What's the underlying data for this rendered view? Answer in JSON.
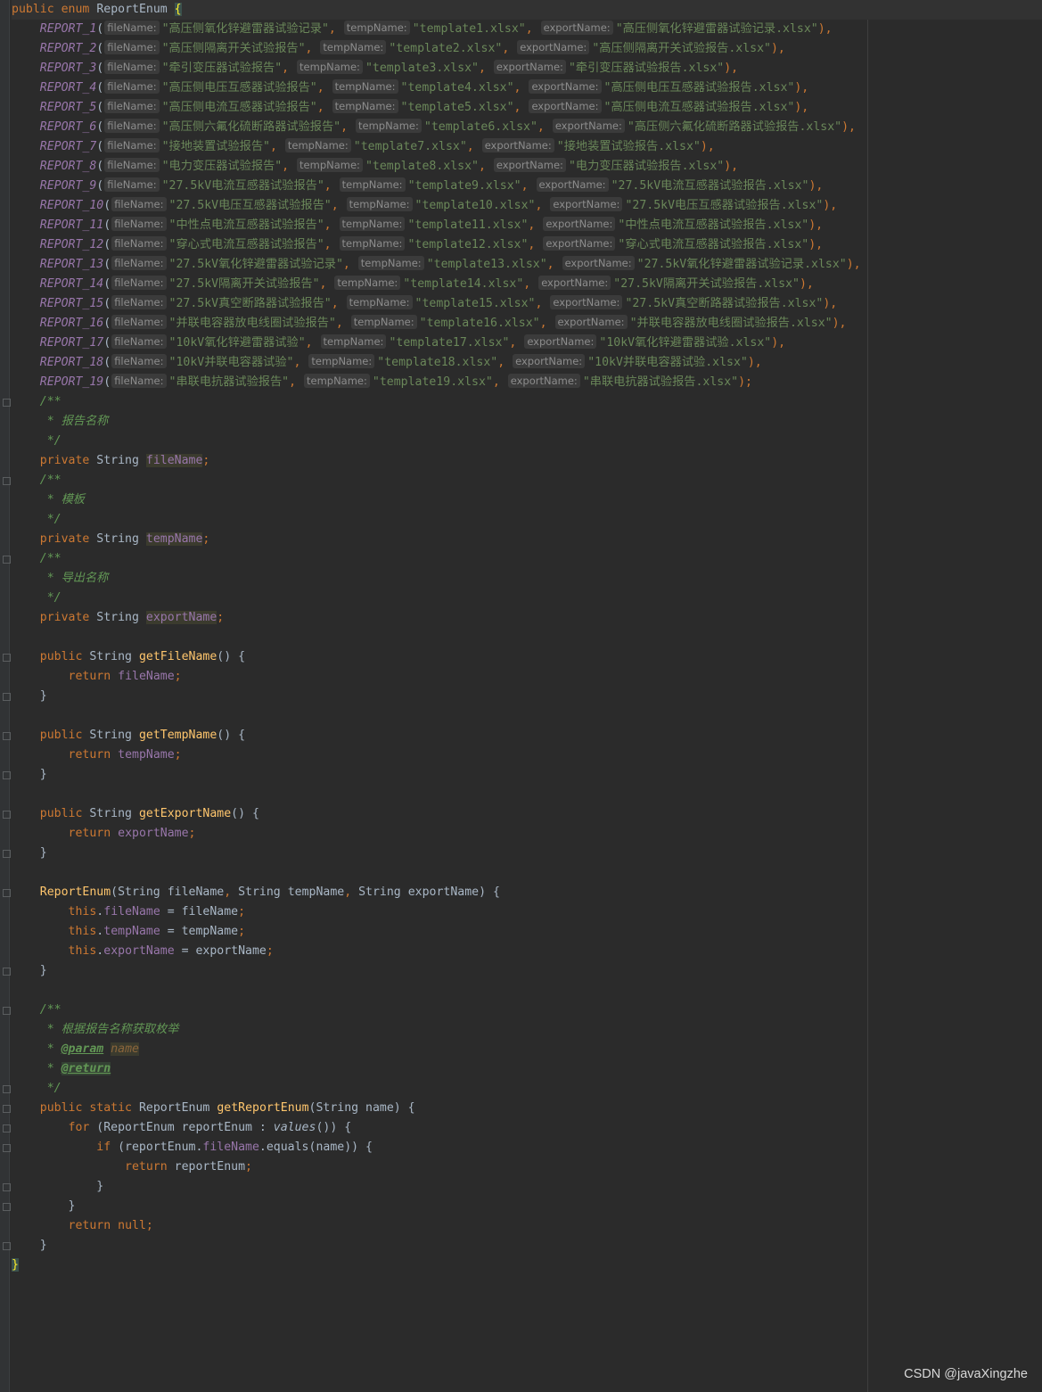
{
  "watermark": "CSDN @javaXingzhe",
  "header": {
    "kw_public": "public",
    "kw_enum": "enum",
    "class_name": "ReportEnum",
    "brace": "{"
  },
  "hints": {
    "file": "fileName:",
    "temp": "tempName:",
    "export": "exportName:"
  },
  "entries": [
    {
      "name": "REPORT_1",
      "file": "\"高压侧氧化锌避雷器试验记录\"",
      "temp": "\"template1.xlsx\"",
      "export": "\"高压侧氧化锌避雷器试验记录.xlsx\"",
      "end": "),"
    },
    {
      "name": "REPORT_2",
      "file": "\"高压侧隔离开关试验报告\"",
      "temp": "\"template2.xlsx\"",
      "export": "\"高压侧隔离开关试验报告.xlsx\"",
      "end": "),"
    },
    {
      "name": "REPORT_3",
      "file": "\"牵引变压器试验报告\"",
      "temp": "\"template3.xlsx\"",
      "export": "\"牵引变压器试验报告.xlsx\"",
      "end": "),"
    },
    {
      "name": "REPORT_4",
      "file": "\"高压侧电压互感器试验报告\"",
      "temp": "\"template4.xlsx\"",
      "export": "\"高压侧电压互感器试验报告.xlsx\"",
      "end": "),"
    },
    {
      "name": "REPORT_5",
      "file": "\"高压侧电流互感器试验报告\"",
      "temp": "\"template5.xlsx\"",
      "export": "\"高压侧电流互感器试验报告.xlsx\"",
      "end": "),"
    },
    {
      "name": "REPORT_6",
      "file": "\"高压侧六氟化硫断路器试验报告\"",
      "temp": "\"template6.xlsx\"",
      "export": "\"高压侧六氟化硫断路器试验报告.xlsx\"",
      "end": "),"
    },
    {
      "name": "REPORT_7",
      "file": "\"接地装置试验报告\"",
      "temp": "\"template7.xlsx\"",
      "export": "\"接地装置试验报告.xlsx\"",
      "end": "),"
    },
    {
      "name": "REPORT_8",
      "file": "\"电力变压器试验报告\"",
      "temp": "\"template8.xlsx\"",
      "export": "\"电力变压器试验报告.xlsx\"",
      "end": "),"
    },
    {
      "name": "REPORT_9",
      "file": "\"27.5kV电流互感器试验报告\"",
      "temp": "\"template9.xlsx\"",
      "export": "\"27.5kV电流互感器试验报告.xlsx\"",
      "end": "),"
    },
    {
      "name": "REPORT_10",
      "file": "\"27.5kV电压互感器试验报告\"",
      "temp": "\"template10.xlsx\"",
      "export": "\"27.5kV电压互感器试验报告.xlsx\"",
      "end": "),"
    },
    {
      "name": "REPORT_11",
      "file": "\"中性点电流互感器试验报告\"",
      "temp": "\"template11.xlsx\"",
      "export": "\"中性点电流互感器试验报告.xlsx\"",
      "end": "),"
    },
    {
      "name": "REPORT_12",
      "file": "\"穿心式电流互感器试验报告\"",
      "temp": "\"template12.xlsx\"",
      "export": "\"穿心式电流互感器试验报告.xlsx\"",
      "end": "),"
    },
    {
      "name": "REPORT_13",
      "file": "\"27.5kV氧化锌避雷器试验记录\"",
      "temp": "\"template13.xlsx\"",
      "export": "\"27.5kV氧化锌避雷器试验记录.xlsx\"",
      "end": "),"
    },
    {
      "name": "REPORT_14",
      "file": "\"27.5kV隔离开关试验报告\"",
      "temp": "\"template14.xlsx\"",
      "export": "\"27.5kV隔离开关试验报告.xlsx\"",
      "end": "),"
    },
    {
      "name": "REPORT_15",
      "file": "\"27.5kV真空断路器试验报告\"",
      "temp": "\"template15.xlsx\"",
      "export": "\"27.5kV真空断路器试验报告.xlsx\"",
      "end": "),"
    },
    {
      "name": "REPORT_16",
      "file": "\"并联电容器放电线圈试验报告\"",
      "temp": "\"template16.xlsx\"",
      "export": "\"并联电容器放电线圈试验报告.xlsx\"",
      "end": "),"
    },
    {
      "name": "REPORT_17",
      "file": "\"10kV氧化锌避雷器试验\"",
      "temp": "\"template17.xlsx\"",
      "export": "\"10kV氧化锌避雷器试验.xlsx\"",
      "end": "),"
    },
    {
      "name": "REPORT_18",
      "file": "\"10kV并联电容器试验\"",
      "temp": "\"template18.xlsx\"",
      "export": "\"10kV并联电容器试验.xlsx\"",
      "end": "),"
    },
    {
      "name": "REPORT_19",
      "file": "\"串联电抗器试验报告\"",
      "temp": "\"template19.xlsx\"",
      "export": "\"串联电抗器试验报告.xlsx\"",
      "end": ");"
    }
  ],
  "comments": {
    "open": "/**",
    "close": " */",
    "file_desc": " * 报告名称",
    "temp_desc": " * 模板",
    "export_desc": " * 导出名称",
    "method_desc": " * 根据报告名称获取枚举",
    "star": " * ",
    "param_tag": "@param",
    "param_name": "name",
    "return_tag": "@return"
  },
  "fields": {
    "kw_private": "private",
    "type": "String",
    "file": "fileName",
    "temp": "tempName",
    "export": "exportName",
    "semi": ";"
  },
  "getters": [
    {
      "name": "getFileName",
      "field": "fileName"
    },
    {
      "name": "getTempName",
      "field": "tempName"
    },
    {
      "name": "getExportName",
      "field": "exportName"
    }
  ],
  "code": {
    "public": "public",
    "static": "static",
    "String": "String",
    "return": "return",
    "this": "this",
    "for": "for",
    "if": "if",
    "null": "null",
    "open_paren_close": "() {",
    "close_brace": "}",
    "ctor_name": "ReportEnum",
    "ctor_params_open": "(String fileName",
    "comma": ",",
    "param2": " String tempName",
    "param3": " String exportName",
    "ctor_params_close": ") {",
    "assign_file": " = fileName",
    "assign_temp": " = tempName",
    "assign_export": " = exportName",
    "dot": ".",
    "method_ret": "ReportEnum",
    "method_name": "getReportEnum",
    "method_params": "(String name) {",
    "for_head": " (ReportEnum reportEnum : ",
    "values_call": "values",
    "for_tail": "()) {",
    "if_head": " (reportEnum.",
    "if_tail": ".equals(name)) {",
    "return_var": " reportEnum",
    "final_brace": "}"
  }
}
